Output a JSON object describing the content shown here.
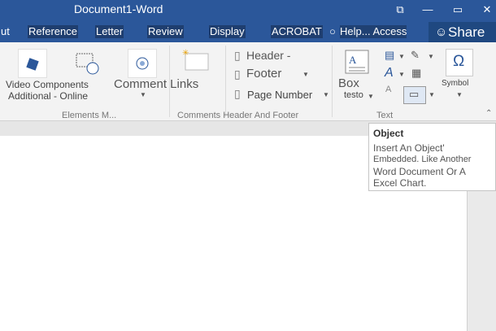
{
  "window": {
    "title": "Document1-Word",
    "controls": [
      "⧉",
      "—",
      "▭",
      "✕"
    ]
  },
  "tabs": {
    "items": [
      "ut",
      "Reference",
      "Letter",
      "Review",
      "Display",
      "ACROBAT"
    ],
    "tell_me": "Help... Access",
    "share": "Share"
  },
  "ribbon": {
    "video_label": "Video Components",
    "additional_label": "Additional - Online",
    "comment_label": "Comment Links",
    "header": "Header -",
    "footer": "Footer",
    "page_number": "Page Number",
    "box_label": "Box",
    "box_sub": "testo",
    "symbol_label": "Symbol",
    "omega": "Ω",
    "groups": {
      "elements": "Elements M...",
      "comments_header": "Comments Header And Footer",
      "text": "Text"
    }
  },
  "tooltip": {
    "title": "Object",
    "lines": [
      "Insert An Object'",
      "Embedded. Like Another",
      "Word Document Or A",
      "Excel Chart."
    ]
  },
  "colors": {
    "accent": "#2b579a",
    "ribbon": "#f3f3f3"
  }
}
